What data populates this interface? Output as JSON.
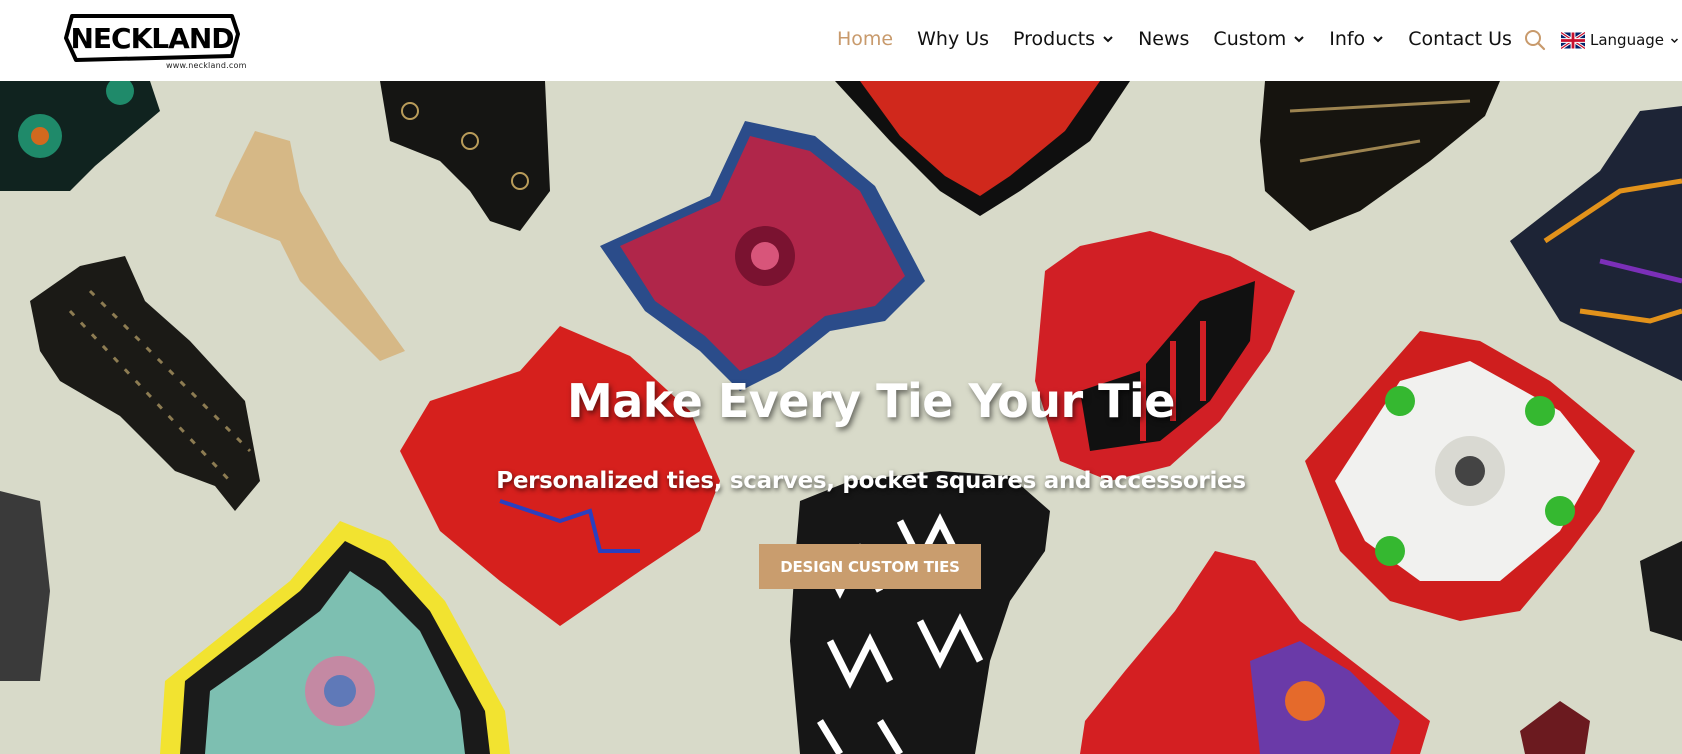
{
  "brand": {
    "logo_text": "NECKLAND",
    "url_text": "www.neckland.com"
  },
  "nav": {
    "items": [
      {
        "label": "Home",
        "active": true,
        "dropdown": false
      },
      {
        "label": "Why Us",
        "active": false,
        "dropdown": false
      },
      {
        "label": "Products",
        "active": false,
        "dropdown": true
      },
      {
        "label": "News",
        "active": false,
        "dropdown": false
      },
      {
        "label": "Custom",
        "active": false,
        "dropdown": true
      },
      {
        "label": "Info",
        "active": false,
        "dropdown": true
      },
      {
        "label": "Contact Us",
        "active": false,
        "dropdown": false
      }
    ],
    "search_icon": "search-icon",
    "language_label": "Language",
    "language_flag": "uk-flag-icon"
  },
  "hero": {
    "title": "Make Every Tie Your Tie",
    "subtitle": "Personalized ties, scarves, pocket squares and accessories",
    "cta_label": "DESIGN CUSTOM TIES"
  },
  "colors": {
    "accent": "#c89a6c",
    "cta_bg": "#c99d6e",
    "hero_bg": "#d8dac9",
    "text": "#111111"
  }
}
